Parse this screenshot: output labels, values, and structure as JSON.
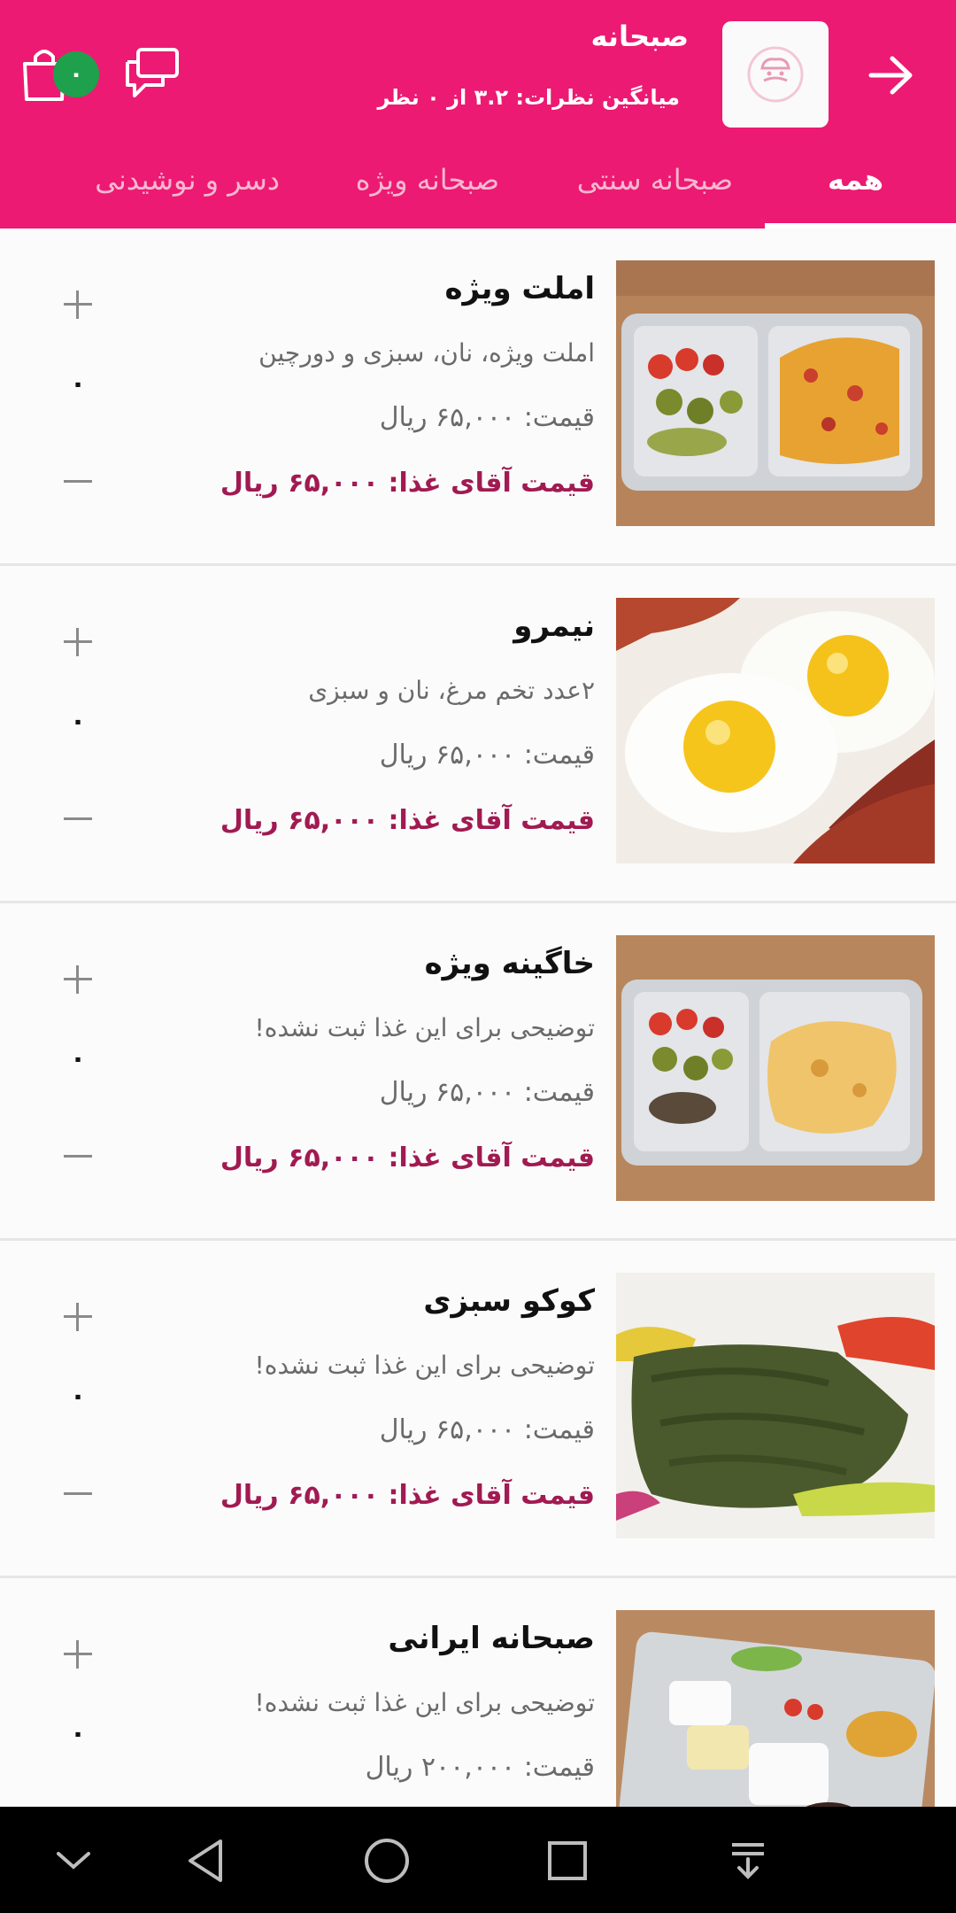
{
  "header": {
    "title": "صبحانه",
    "rating": "میانگین نظرات: ۳.۲ از ۰ نظر",
    "cart_count": "۰",
    "colors": {
      "primary": "#ec1a72",
      "badge": "#1fa04c",
      "special_price": "#a11a52"
    },
    "icons": {
      "back": "arrow-right-icon",
      "logo": "chef-logo-icon",
      "chat": "chat-bubbles-icon",
      "cart": "shopping-bag-icon"
    }
  },
  "tabs": [
    {
      "label": "همه",
      "active": true
    },
    {
      "label": "صبحانه سنتی",
      "active": false
    },
    {
      "label": "صبحانه ویژه",
      "active": false
    },
    {
      "label": "دسر و نوشیدنی",
      "active": false
    }
  ],
  "items": [
    {
      "name": "املت ویژه",
      "desc": "املت ویژه، نان، سبزی و دورچین",
      "price": "قیمت: ۶۵,۰۰۰ ریال",
      "special": "قیمت آقای غذا: ۶۵,۰۰۰ ریال",
      "qty": "۰"
    },
    {
      "name": "نیمرو",
      "desc": "۲عدد تخم مرغ،  نان و سبزی",
      "price": "قیمت: ۶۵,۰۰۰ ریال",
      "special": "قیمت آقای غذا: ۶۵,۰۰۰ ریال",
      "qty": "۰"
    },
    {
      "name": "خاگینه ویژه",
      "desc": "توضیحی برای این غذا ثبت نشده!",
      "price": "قیمت: ۶۵,۰۰۰ ریال",
      "special": "قیمت آقای غذا: ۶۵,۰۰۰ ریال",
      "qty": "۰"
    },
    {
      "name": "کوکو سبزی",
      "desc": "توضیحی برای این غذا ثبت نشده!",
      "price": "قیمت: ۶۵,۰۰۰ ریال",
      "special": "قیمت آقای غذا: ۶۵,۰۰۰ ریال",
      "qty": "۰"
    },
    {
      "name": "صبحانه ایرانی",
      "desc": "توضیحی برای این غذا ثبت نشده!",
      "price": "قیمت: ۲۰۰,۰۰۰ ریال",
      "special": "",
      "qty": "۰"
    }
  ],
  "navbar": {
    "icons": [
      "chevron-down-icon",
      "back-triangle-icon",
      "home-circle-icon",
      "recents-square-icon",
      "notification-pull-icon"
    ]
  }
}
